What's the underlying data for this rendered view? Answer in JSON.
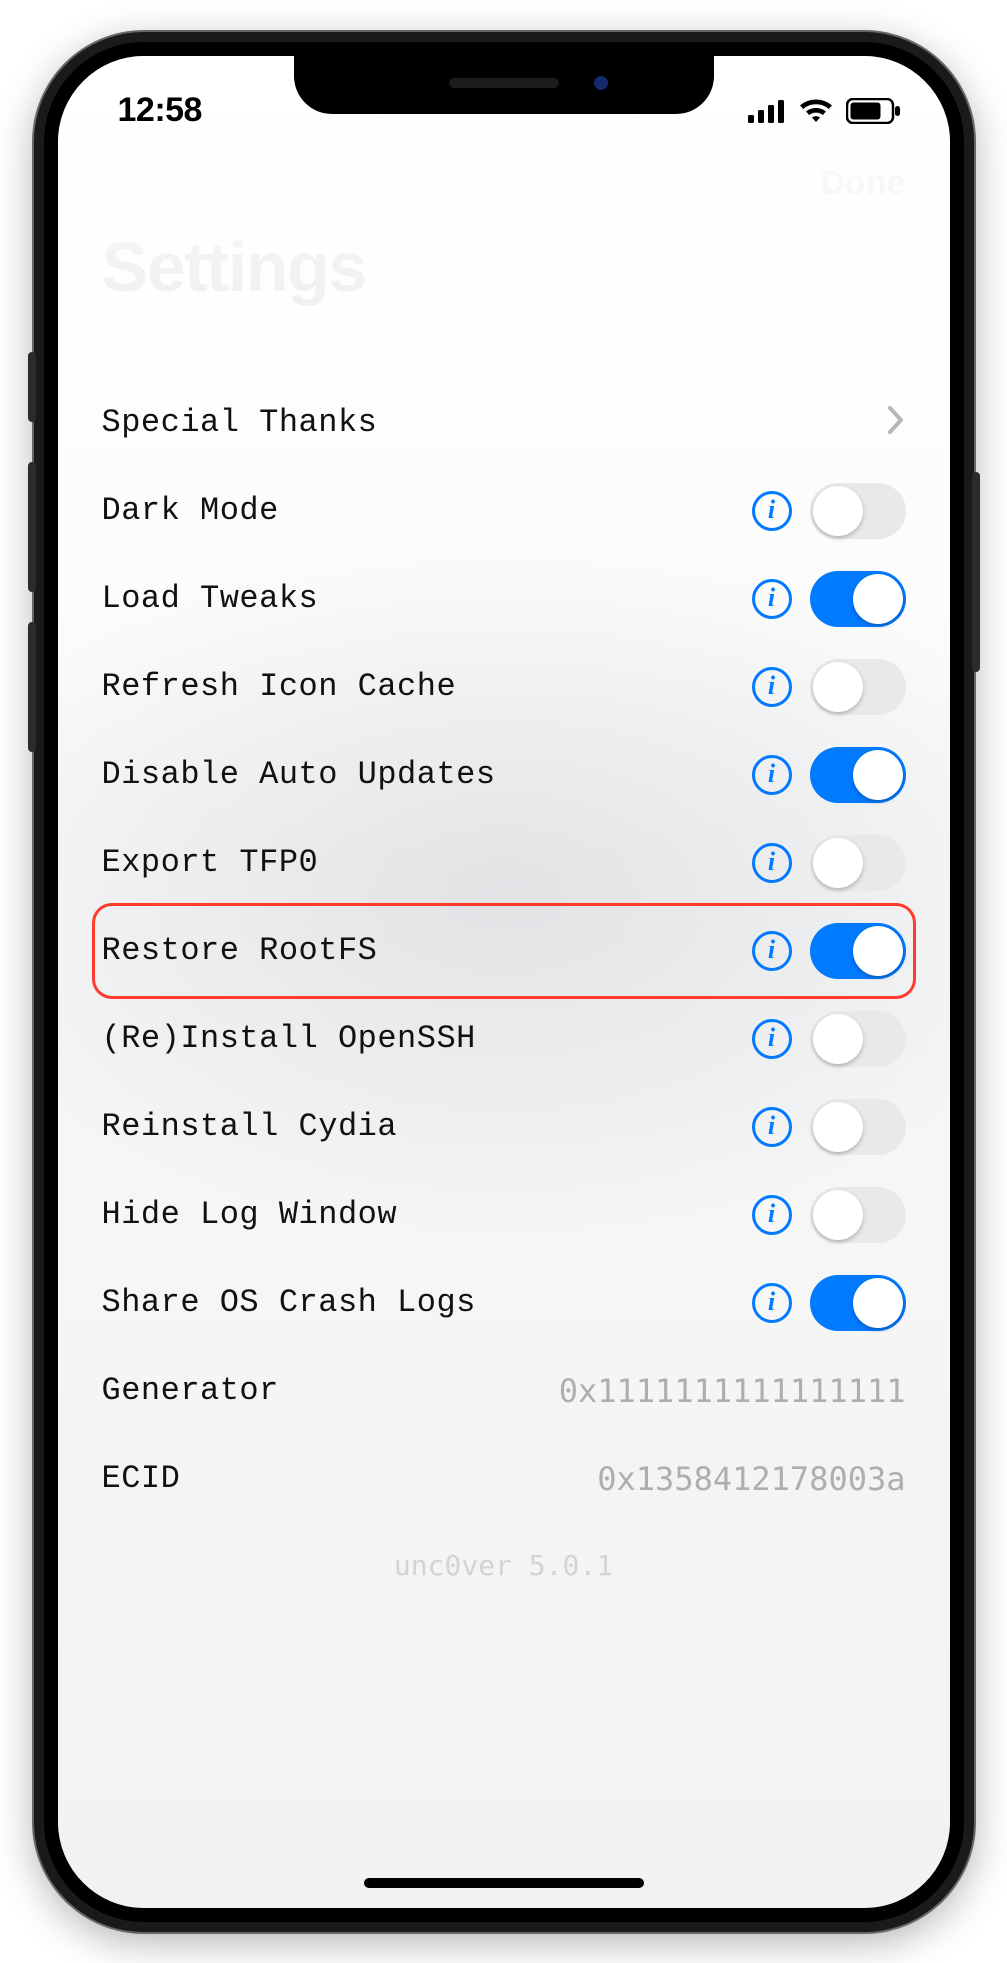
{
  "status": {
    "time": "12:58"
  },
  "nav": {
    "done": "Done"
  },
  "title": "Settings",
  "rows": {
    "special_thanks": {
      "label": "Special Thanks"
    },
    "dark_mode": {
      "label": "Dark Mode",
      "on": false
    },
    "load_tweaks": {
      "label": "Load Tweaks",
      "on": true
    },
    "refresh_icon_cache": {
      "label": "Refresh Icon Cache",
      "on": false
    },
    "disable_auto_updates": {
      "label": "Disable Auto Updates",
      "on": true
    },
    "export_tfp0": {
      "label": "Export TFP0",
      "on": false
    },
    "restore_rootfs": {
      "label": "Restore RootFS",
      "on": true,
      "highlighted": true
    },
    "reinstall_openssh": {
      "label": "(Re)Install OpenSSH",
      "on": false
    },
    "reinstall_cydia": {
      "label": "Reinstall Cydia",
      "on": false
    },
    "hide_log_window": {
      "label": "Hide Log Window",
      "on": false
    },
    "share_os_crash_logs": {
      "label": "Share OS Crash Logs",
      "on": true
    },
    "generator": {
      "label": "Generator",
      "value": "0x1111111111111111"
    },
    "ecid": {
      "label": "ECID",
      "value": "0x1358412178003a"
    }
  },
  "footer": {
    "version": "unc0ver 5.0.1"
  },
  "icons": {
    "info_glyph": "i"
  },
  "colors": {
    "accent": "#007aff",
    "highlight": "#ff3b30"
  }
}
